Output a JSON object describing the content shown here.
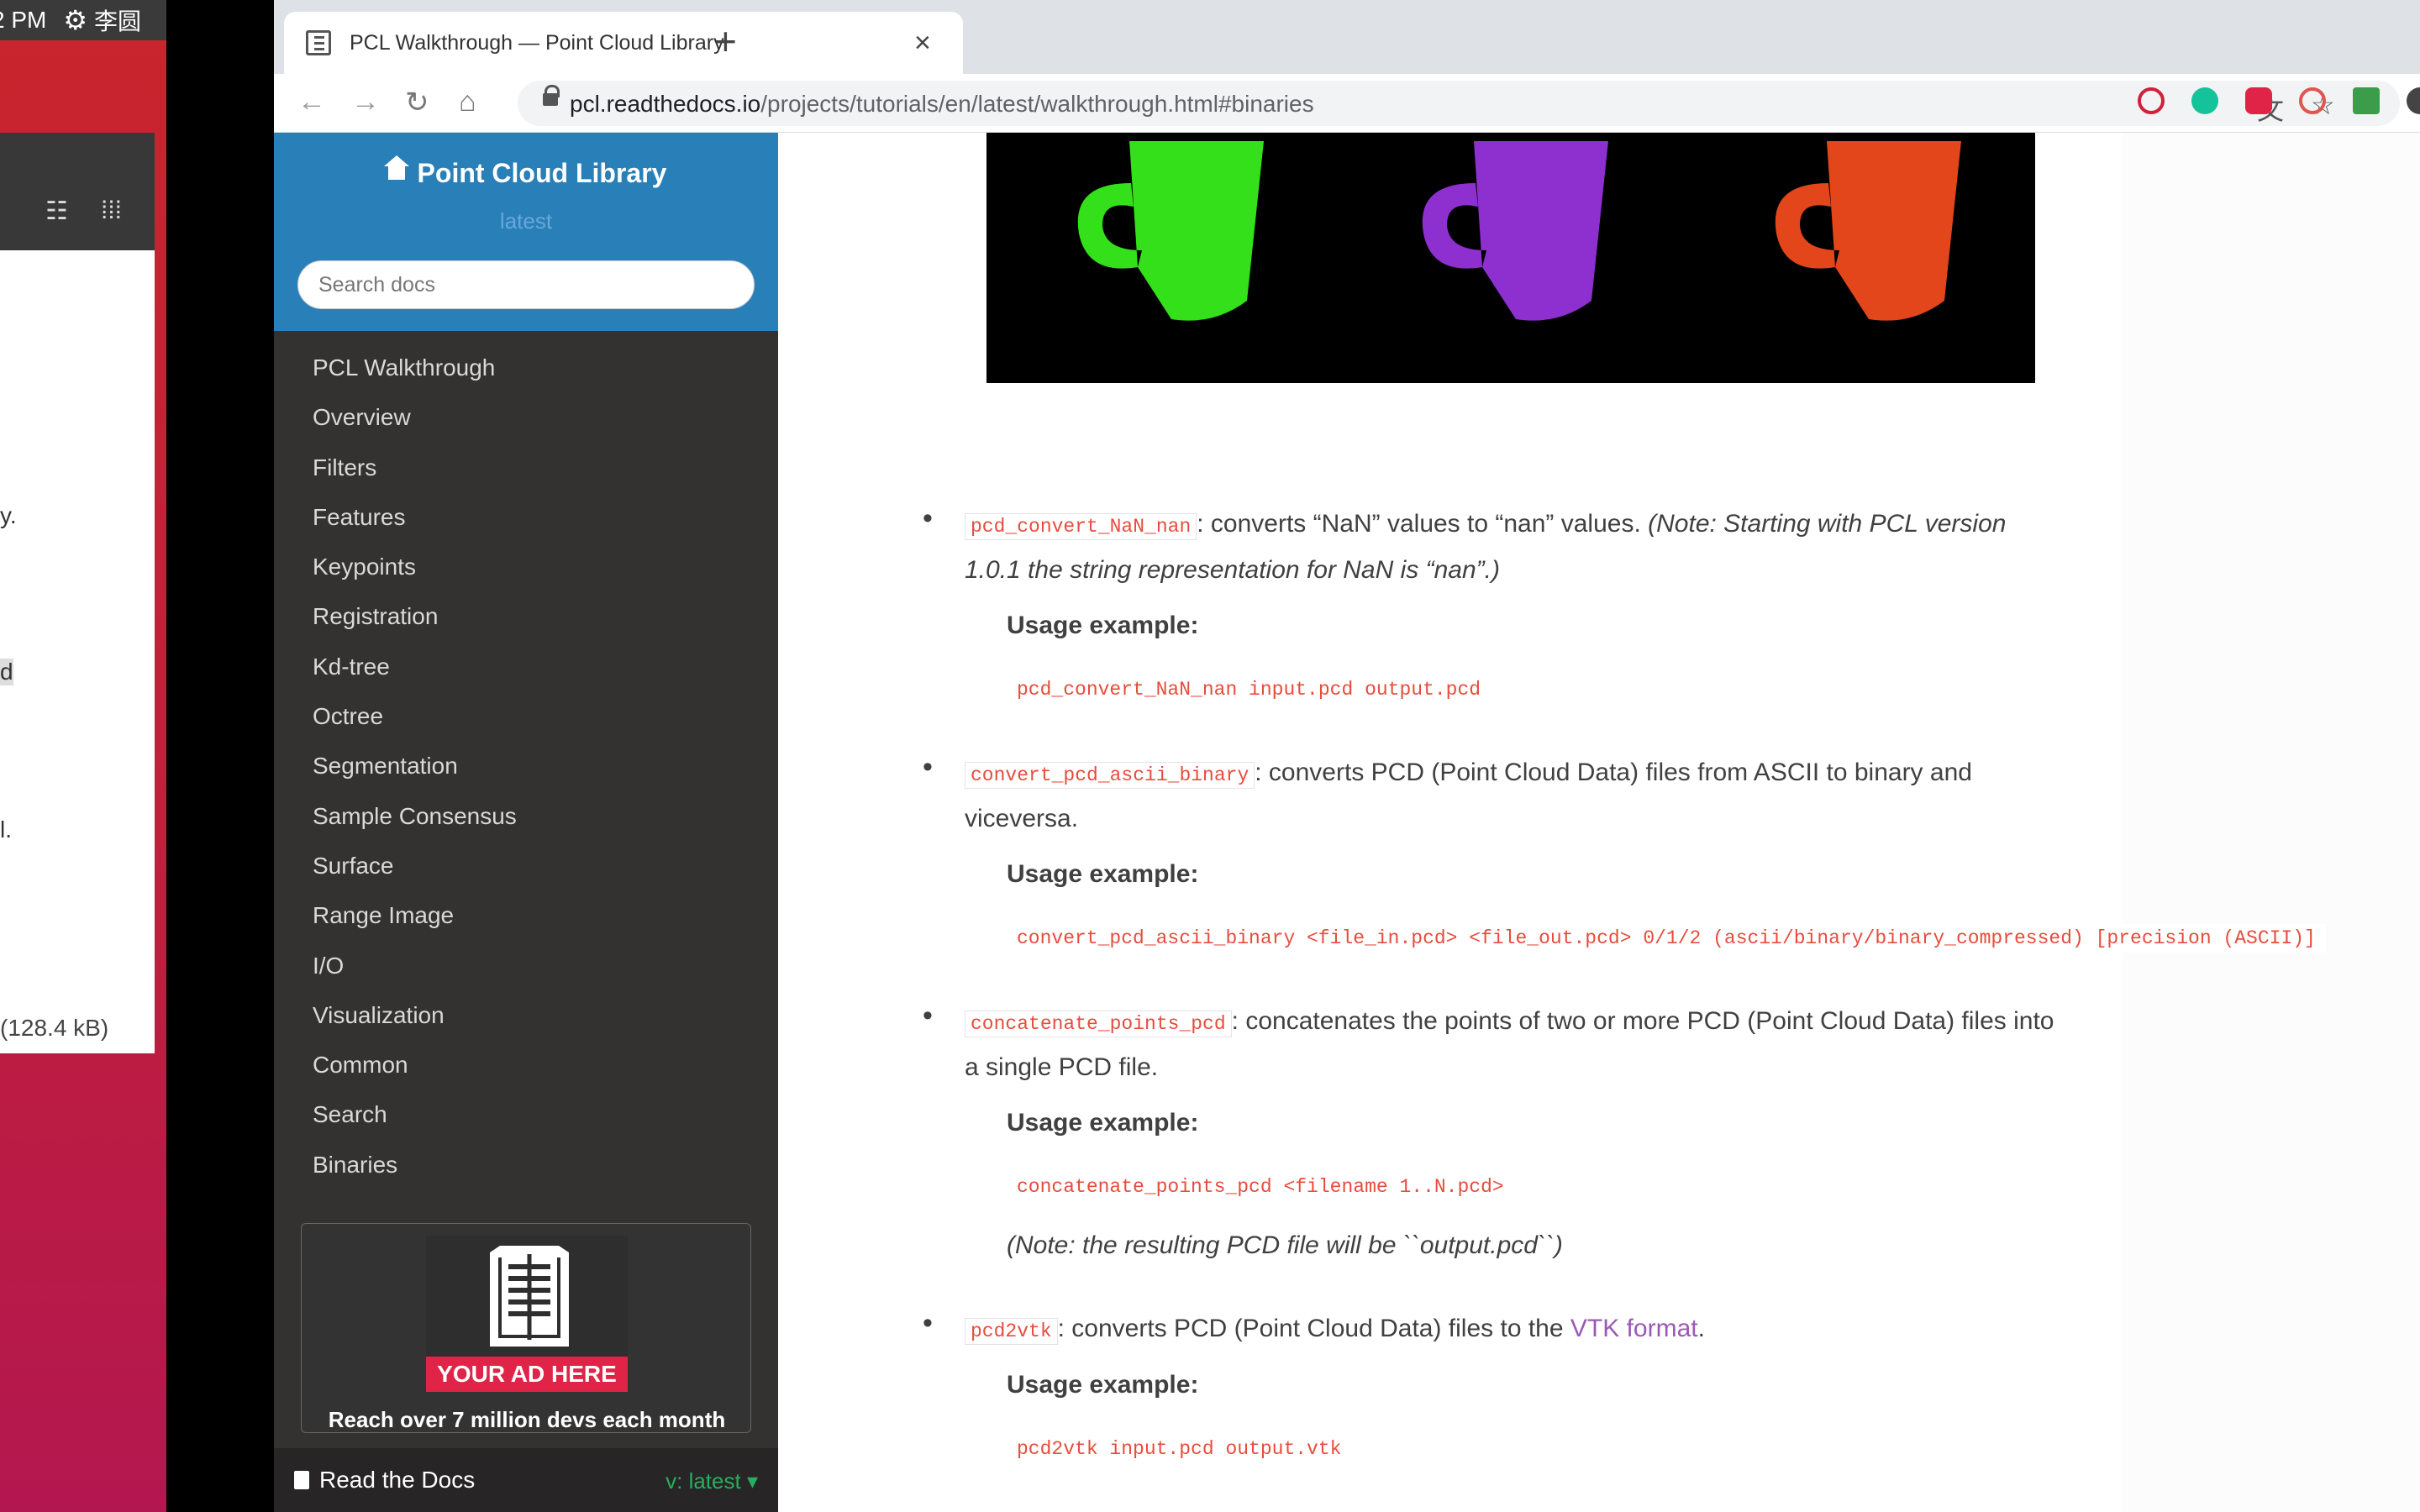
{
  "desktop": {
    "clock": "2 PM",
    "ime": "李圆",
    "window_size": "(128.4 kB)",
    "fragments": [
      "y.",
      "d",
      "l."
    ]
  },
  "browser": {
    "tab_title": "PCL Walkthrough — Point Cloud Library",
    "url_host": "pcl.readthedocs.io",
    "url_path": "/projects/tutorials/en/latest/walkthrough.html#binaries"
  },
  "sidebar": {
    "project": "Point Cloud Library",
    "version": "latest",
    "search_placeholder": "Search docs",
    "nav": [
      "PCL Walkthrough",
      "Overview",
      "Filters",
      "Features",
      "Keypoints",
      "Registration",
      "Kd-tree",
      "Octree",
      "Segmentation",
      "Sample Consensus",
      "Surface",
      "Range Image",
      "I/O",
      "Visualization",
      "Common",
      "Search",
      "Binaries"
    ],
    "ad_label": "YOUR AD HERE",
    "ad_text": "Reach over 7 million devs each month",
    "rtd_label": "Read the Docs",
    "rtd_version": "v: latest"
  },
  "content": {
    "mug_colors": [
      "#33e01a",
      "#8e2fd0",
      "#e2461a"
    ],
    "items": [
      {
        "code": "pcd_convert_NaN_nan",
        "text": ": converts “NaN” values to “nan” values. ",
        "note": "(Note: Starting with PCL version 1.0.1 the string representation for NaN is “nan”.)",
        "usage_label": "Usage example:",
        "command": "pcd_convert_NaN_nan input.pcd output.pcd"
      },
      {
        "code": "convert_pcd_ascii_binary",
        "text": ": converts PCD (Point Cloud Data) files from ASCII to binary and viceversa.",
        "usage_label": "Usage example:",
        "command": "convert_pcd_ascii_binary <file_in.pcd> <file_out.pcd> 0/1/2 (ascii/binary/binary_compressed) [precision (ASCII)]"
      },
      {
        "code": "concatenate_points_pcd",
        "text": ": concatenates the points of two or more PCD (Point Cloud Data) files into a single PCD file.",
        "usage_label": "Usage example:",
        "command": "concatenate_points_pcd <filename 1..N.pcd>",
        "after_note": "(Note: the resulting PCD file will be ``output.pcd``)"
      },
      {
        "code": "pcd2vtk",
        "text": ": converts PCD (Point Cloud Data) files to the ",
        "link": "VTK format",
        "text_end": ".",
        "usage_label": "Usage example:",
        "command": "pcd2vtk input.pcd output.vtk"
      }
    ]
  }
}
